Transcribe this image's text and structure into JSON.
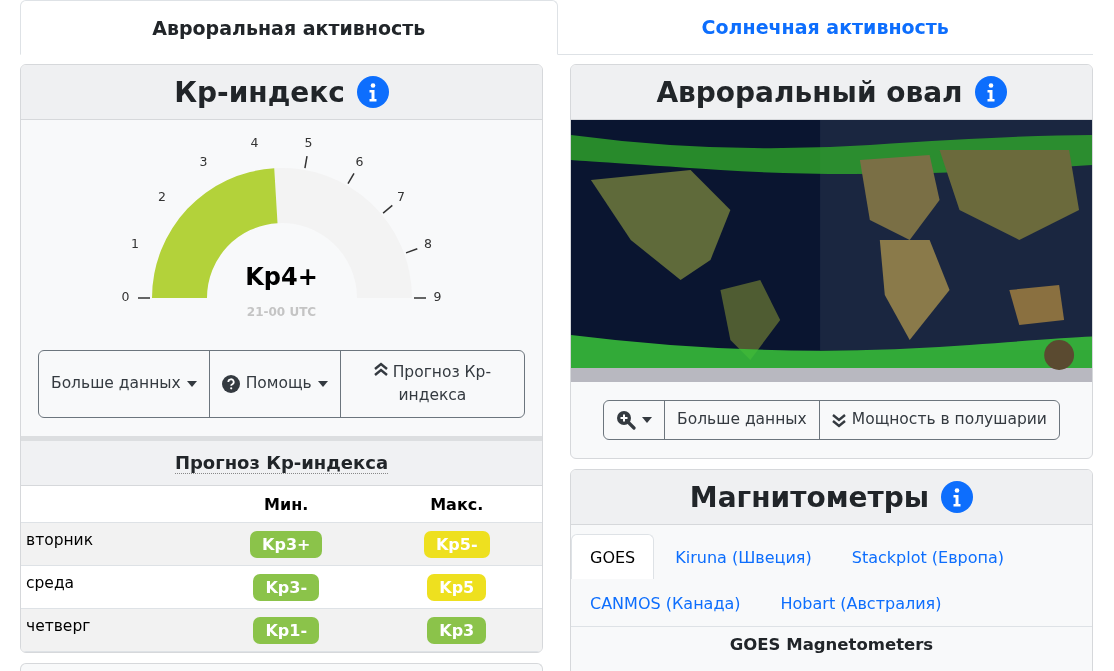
{
  "tabs": [
    {
      "label": "Авроральная активность",
      "selected": true
    },
    {
      "label": "Солнечная активность",
      "selected": false
    }
  ],
  "kp_card": {
    "title": "Кр-индекс",
    "gauge": {
      "ticks": [
        "0",
        "1",
        "2",
        "3",
        "4",
        "5",
        "6",
        "7",
        "8",
        "9"
      ],
      "level": 0.481,
      "value": "Kp4+",
      "time": "21-00 UTC"
    },
    "buttons": [
      {
        "kind": "dropdown",
        "label": "Больше данных"
      },
      {
        "kind": "help",
        "label": "Помощь"
      },
      {
        "kind": "up",
        "label": "Прогноз Кр-индекса"
      }
    ]
  },
  "forecast": {
    "title": "Прогноз Кр-индекса",
    "columns": [
      "Мин.",
      "Макс."
    ],
    "rows": [
      {
        "day": "вторник",
        "min": {
          "text": "Kp3+",
          "color": "#8bc34a"
        },
        "max": {
          "text": "Kp5-",
          "color": "#eee01f"
        }
      },
      {
        "day": "среда",
        "min": {
          "text": "Kp3-",
          "color": "#8bc34a"
        },
        "max": {
          "text": "Kp5",
          "color": "#eee01f"
        }
      },
      {
        "day": "четверг",
        "min": {
          "text": "Kp1-",
          "color": "#8bc34a"
        },
        "max": {
          "text": "Kp3",
          "color": "#8bc34a"
        }
      }
    ]
  },
  "oval_card": {
    "title": "Авроральный овал",
    "buttons": [
      {
        "kind": "zoom"
      },
      {
        "kind": "plain",
        "label": "Больше данных"
      },
      {
        "kind": "down",
        "label": "Мощность в полушарии"
      }
    ]
  },
  "magnetometers": {
    "title": "Магнитометры",
    "tabs": [
      {
        "label": "GOES",
        "selected": true
      },
      {
        "label": "Kiruna (Швеция)",
        "selected": false
      },
      {
        "label": "Stackplot (Европа)",
        "selected": false
      },
      {
        "label": "CANMOS (Канада)",
        "selected": false
      },
      {
        "label": "Hobart (Австралия)",
        "selected": false
      }
    ],
    "chart_title": "GOES Magnetometers"
  }
}
